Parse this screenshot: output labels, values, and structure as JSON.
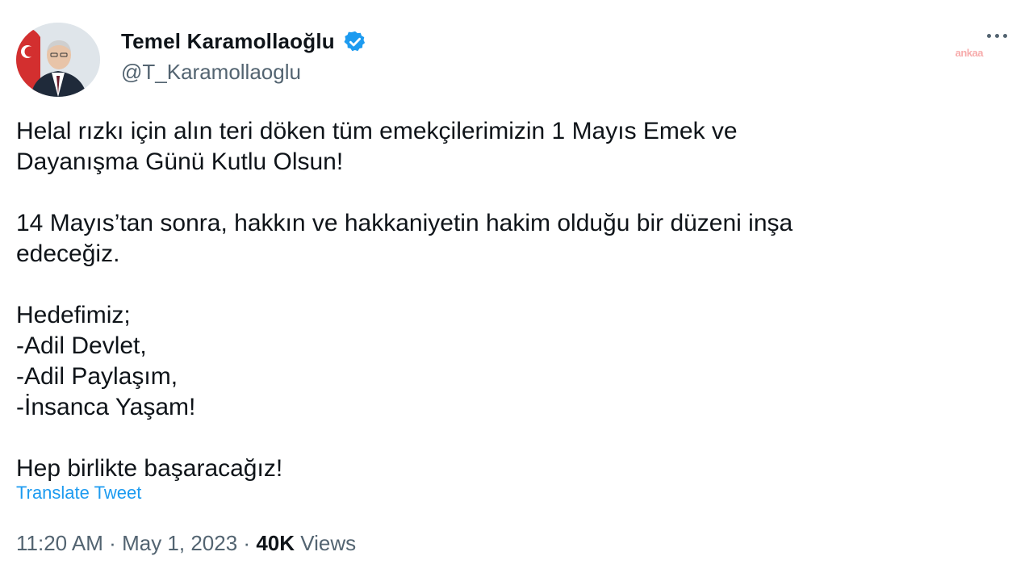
{
  "author": {
    "display_name": "Temel Karamollaoğlu",
    "handle": "@T_Karamollaoglu",
    "verified_icon": "verified-badge-icon",
    "verified_color": "#1d9bf0"
  },
  "watermark": "ankaa",
  "tweet": {
    "lines": [
      "Helal rızkı için alın teri döken tüm emekçilerimizin 1 Mayıs Emek ve",
      "Dayanışma Günü Kutlu Olsun!",
      "14 Mayıs’tan sonra, hakkın ve hakkaniyetin hakim olduğu bir düzeni inşa",
      "edeceğiz.",
      "Hedefimiz;",
      "-Adil Devlet,",
      "-Adil Paylaşım,",
      "-İnsanca Yaşam!",
      "Hep birlikte başaracağız!"
    ],
    "translate_label": "Translate Tweet"
  },
  "meta": {
    "time": "11:20 AM",
    "separator": "·",
    "date": "May 1, 2023",
    "views_count": "40K",
    "views_label": "Views"
  },
  "colors": {
    "text": "#0f1419",
    "secondary": "#536471",
    "link": "#1d9bf0"
  }
}
